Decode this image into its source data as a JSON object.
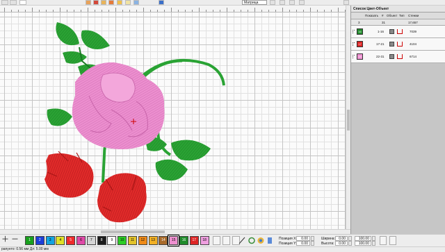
{
  "toolbar": {
    "zoom_select_value": "Матрица"
  },
  "panel": {
    "title": "Список Цвет-Объект",
    "columns": [
      "Показать",
      "#",
      "Объект",
      "Тип",
      "Стежки"
    ],
    "summary": {
      "count": "3",
      "range": "31",
      "stitches": "17,657"
    },
    "rows": [
      {
        "color_index": "16",
        "color": "#1f8b2a",
        "range": "1-16",
        "stitches": "7039"
      },
      {
        "color_index": "17",
        "color": "#dd2525",
        "range": "17-21",
        "stitches": "4104"
      },
      {
        "color_index": "15",
        "color": "#ee8fd0",
        "range": "22-31",
        "stitches": "6714"
      }
    ]
  },
  "palette": {
    "swatches": [
      {
        "label": "1",
        "color": "#18a01d"
      },
      {
        "label": "2",
        "color": "#1d3ed8"
      },
      {
        "label": "3",
        "color": "#12a3e0"
      },
      {
        "label": "4",
        "color": "#e0e026"
      },
      {
        "label": "5",
        "color": "#ef2a2a"
      },
      {
        "label": "6",
        "color": "#e04aa8"
      },
      {
        "label": "7",
        "color": "#d5d5d5"
      },
      {
        "label": "8",
        "color": "#1c1c1c"
      },
      {
        "label": "9",
        "color": "#ffffff"
      },
      {
        "label": "10",
        "color": "#2ccd25"
      },
      {
        "label": "11",
        "color": "#e2c22a"
      },
      {
        "label": "12",
        "color": "#ef8a17"
      },
      {
        "label": "13",
        "color": "#f2b025"
      },
      {
        "label": "14",
        "color": "#a86a2a"
      },
      {
        "label": "15",
        "color": "#ee8fd0"
      },
      {
        "label": "16",
        "color": "#1f8b2a"
      },
      {
        "label": "17",
        "color": "#dd2525"
      },
      {
        "label": "18",
        "color": "#ef9fe0"
      }
    ],
    "selected": "15",
    "pos_x_label": "Позиция X:",
    "pos_y_label": "Позиция Y:",
    "pos_x": "0.00",
    "pos_y": "0.00",
    "width_label": "Ширина:",
    "height_label": "Высота:",
    "width": "0.00",
    "height": "0.00",
    "scale_w": "100.00",
    "scale_h": "100.00"
  },
  "status": {
    "text": "рапунто: 0.56 мм Дл: 5.00 мм"
  }
}
